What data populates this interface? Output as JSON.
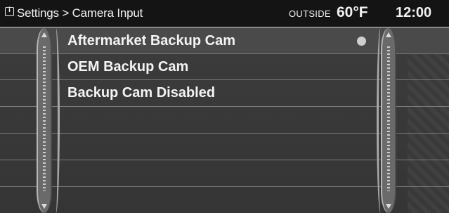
{
  "header": {
    "breadcrumb": "Settings > Camera Input",
    "outside_label": "OUTSIDE",
    "outside_temp": "60°F",
    "clock": "12:00"
  },
  "menu": {
    "items": [
      {
        "label": "Aftermarket Backup Cam",
        "selected": true
      },
      {
        "label": "OEM Backup Cam",
        "selected": false
      },
      {
        "label": "Backup Cam Disabled",
        "selected": false
      }
    ]
  },
  "icons": {
    "info": "info-icon",
    "selected_indicator": "radio-dot-icon",
    "scroll_up": "arrow-up-icon",
    "scroll_down": "arrow-down-icon"
  },
  "colors": {
    "header_bg": "#141414",
    "content_bg": "#3a3a3a",
    "selected_row_bg": "#4a4a4a",
    "text": "#f4f4f4"
  }
}
